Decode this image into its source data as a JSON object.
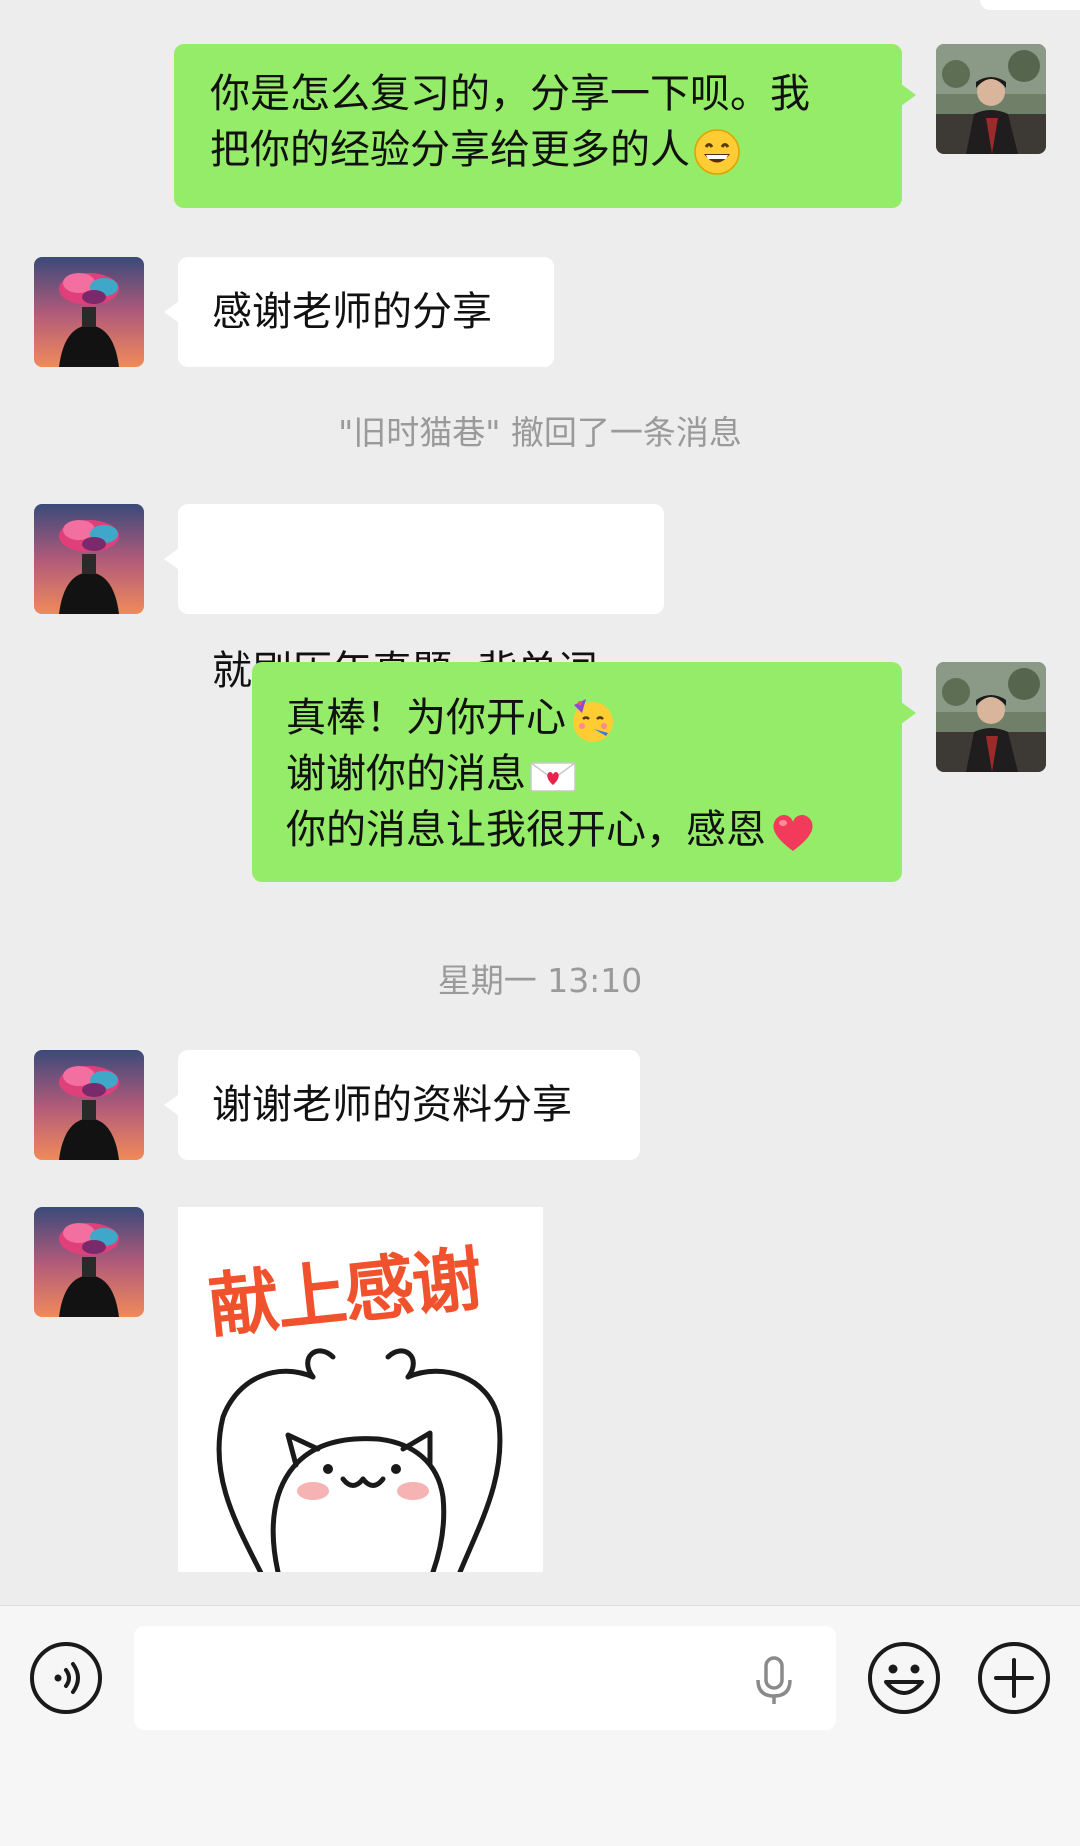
{
  "messages": {
    "m1": {
      "line1": "你是怎么复习的，分享一下呗。我",
      "line2": "把你的经验分享给更多的人",
      "emoji": "grinning-face"
    },
    "m2": {
      "text": "感谢老师的分享"
    },
    "recall_notice": "\"旧时猫巷\" 撤回了一条消息",
    "m3": {
      "text": "就刷历年真题  背单词"
    },
    "m4": {
      "line1": "真棒！为你开心",
      "line1_emoji": "partying-face",
      "line2": "谢谢你的消息",
      "line2_emoji": "love-letter",
      "line3": "你的消息让我很开心，感恩",
      "line3_emoji": "red-heart"
    },
    "timestamp": "星期一 13:10",
    "m5": {
      "text": "谢谢老师的资料分享"
    },
    "m6": {
      "sticker_text": "献上感谢",
      "sticker_icon": "cat-raising-arms"
    }
  },
  "input": {
    "placeholder": "",
    "voice_icon": "voice-icon",
    "mic_icon": "microphone-icon",
    "emoji_icon": "emoji-icon",
    "plus_icon": "plus-icon"
  },
  "colors": {
    "background": "#ededed",
    "my_bubble": "#95ec69",
    "their_bubble": "#ffffff",
    "sticker_text": "#f0522d"
  }
}
